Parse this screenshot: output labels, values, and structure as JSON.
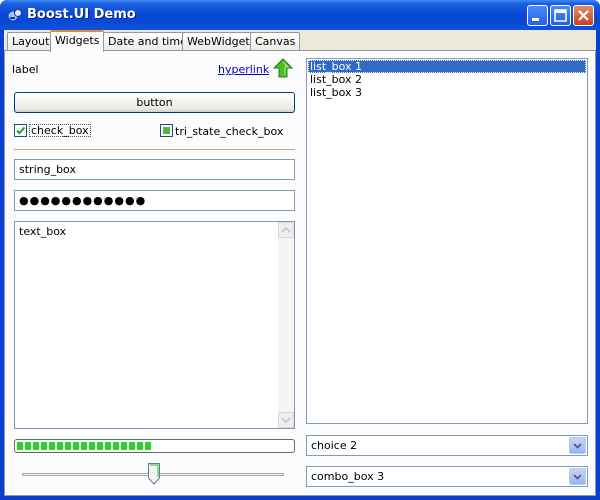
{
  "window": {
    "title": "Boost.UI Demo",
    "accent_color": "#0a3fd1",
    "icons": [
      "app-icon",
      "minimize-icon",
      "maximize-icon",
      "close-icon"
    ]
  },
  "tabs": [
    {
      "label": "Layout",
      "active": false
    },
    {
      "label": "Widgets",
      "active": true
    },
    {
      "label": "Date and time",
      "active": false
    },
    {
      "label": "WebWidget",
      "active": false
    },
    {
      "label": "Canvas",
      "active": false
    }
  ],
  "widgets": {
    "label": "label",
    "hyperlink": "hyperlink",
    "arrow_icon": "green-up-arrow-icon",
    "button": "button",
    "check_box": {
      "label": "check_box",
      "checked": true
    },
    "tri_state_check_box": {
      "label": "tri_state_check_box",
      "state": "indeterminate"
    },
    "string_box": {
      "value": "string_box"
    },
    "password_box": {
      "value": "●●●●●●●●●●●●"
    },
    "text_box": {
      "value": "text_box"
    },
    "progress": {
      "fraction": 0.5,
      "color": "#2cd22c"
    },
    "slider": {
      "fraction": 0.5
    }
  },
  "list_box": {
    "items": [
      "list_box 1",
      "list_box 2",
      "list_box 3"
    ],
    "selected_index": 0
  },
  "choice": {
    "value": "choice 2"
  },
  "combo_box": {
    "value": "combo_box 3"
  }
}
